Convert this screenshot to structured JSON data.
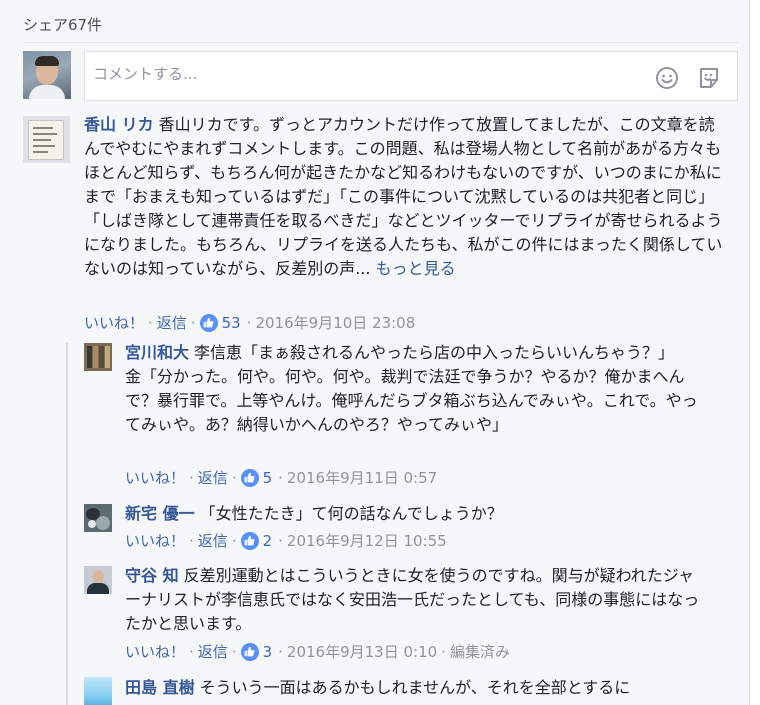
{
  "share_count": "シェア67件",
  "composer": {
    "placeholder": "コメントする..."
  },
  "like_label": "いいね！",
  "reply_label": "返信",
  "comments": [
    {
      "author": "香山 リカ",
      "text": "香山リカです。ずっとアカウントだけ作って放置してましたが、この文章を読んでやむにやまれずコメントします。この問題、私は登場人物として名前があがる方々もほとんど知らず、もちろん何が起きたかなど知るわけもないのですが、いつのまにか私にまで「おまえも知っているはずだ」「この事件について沈黙しているのは共犯者と同じ」「しばき隊として連帯責任を取るべきだ」などとツイッターでリプライが寄せられるようになりました。もちろん、リプライを送る人たちも、私がこの件にはまったく関係していないのは知っていながら、反差別の声...",
      "more": "もっと見る",
      "likes": "53",
      "date": "2016年9月10日 23:08"
    },
    {
      "author": "宮川和大",
      "text": "李信恵「まぁ殺されるんやったら店の中入ったらいいんちゃう？」",
      "text2": "金「分かった。何や。何や。何や。裁判で法廷で争うか？やるか？俺かまへんで？暴行罪で。上等やんけ。俺呼んだらブタ箱ぶち込んでみぃや。これで。やってみぃや。あ？納得いかへんのやろ？やってみぃや」",
      "likes": "5",
      "date": "2016年9月11日 0:57"
    },
    {
      "author": "新宅 優一",
      "text": "「女性たたき」て何の話なんでしょうか？",
      "likes": "2",
      "date": "2016年9月12日 10:55"
    },
    {
      "author": "守谷 知",
      "text": "反差別運動とはこういうときに女を使うのですね。関与が疑われたジャーナリストが李信恵氏ではなく安田浩一氏だったとしても、同様の事態にはなったかと思います。",
      "likes": "3",
      "date": "2016年9月13日 0:10",
      "edited": "編集済み"
    },
    {
      "author": "田島 直樹",
      "text": "そういう一面はあるかもしれませんが、それを全部とするに"
    }
  ]
}
